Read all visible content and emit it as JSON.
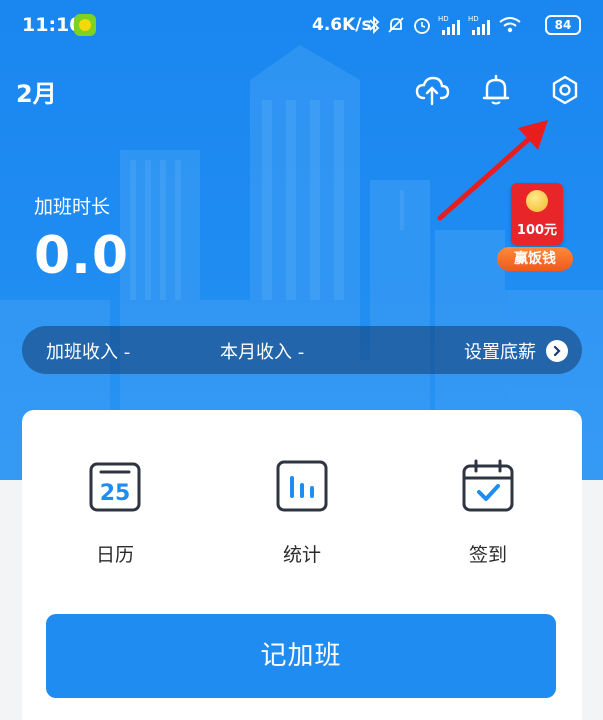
{
  "status_bar": {
    "time": "11:10",
    "network_speed": "4.6K/s",
    "battery": "84",
    "signal_label": "HD"
  },
  "header": {
    "month": "2月",
    "icons": [
      "cloud-upload-icon",
      "bell-icon",
      "settings-hexagon-icon"
    ]
  },
  "overtime": {
    "label": "加班时长",
    "value": "0.0"
  },
  "promo": {
    "amount": "100元",
    "cta": "赢饭钱"
  },
  "income": {
    "overtime_income": "加班收入 -",
    "month_income": "本月收入 -",
    "set_base_salary": "设置底薪"
  },
  "features": [
    {
      "label": "日历",
      "icon": "calendar-icon",
      "day": "25"
    },
    {
      "label": "统计",
      "icon": "statistics-icon"
    },
    {
      "label": "签到",
      "icon": "check-in-icon"
    }
  ],
  "primary_action": {
    "label": "记加班"
  },
  "colors": {
    "brand_blue": "#1f8cf2",
    "promo_red": "#e8262a",
    "annotation_red": "#e81e1e"
  }
}
